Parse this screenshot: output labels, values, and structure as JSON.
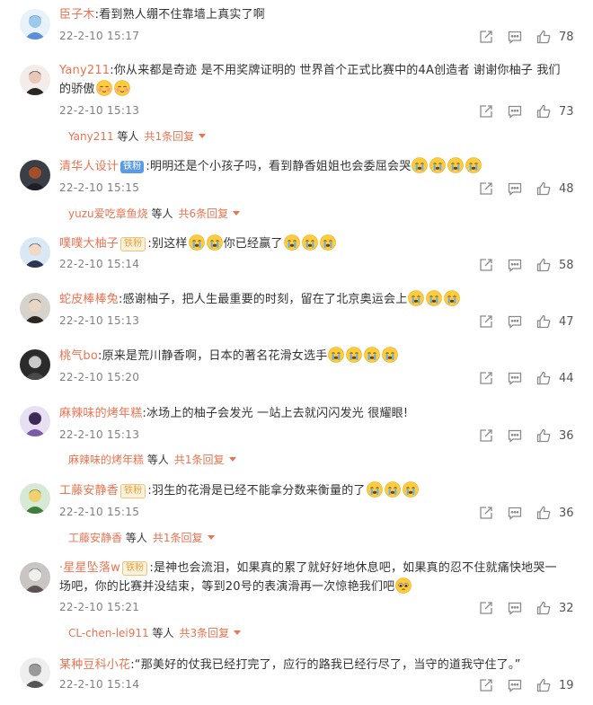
{
  "comments": [
    {
      "user": "臣子木",
      "badge": "",
      "badge_type": "",
      "text": ":看到熟人绷不住靠墙上真实了啊",
      "emojis_after": 0,
      "emoji_kind": "",
      "time": "22-2-10 15:17",
      "likes": "78",
      "reply_user": "",
      "reply_mid": "",
      "reply_more": ""
    },
    {
      "user": "Yany211",
      "badge": "",
      "badge_type": "",
      "text": ":你从来都是奇迹 是不用奖牌证明的 世界首个正式比赛中的4A创造者 谢谢你柚子 我们的骄傲",
      "emojis_after": 2,
      "emoji_kind": "blush",
      "time": "22-2-10 15:13",
      "likes": "73",
      "reply_user": "Yany211",
      "reply_mid": "等人",
      "reply_more": "共1条回复"
    },
    {
      "user": "清华人设计",
      "badge": "铁粉",
      "badge_type": "blue",
      "text": ":明明还是个小孩子吗，看到静香姐姐也会委屈会哭",
      "emojis_after": 4,
      "emoji_kind": "cry",
      "time": "22-2-10 15:15",
      "likes": "48",
      "reply_user": "yuzu爱吃章鱼烧",
      "reply_mid": "等人",
      "reply_more": "共6条回复"
    },
    {
      "user": "噗噗大柚子",
      "badge": "铁粉",
      "badge_type": "gold",
      "text": ":别这样",
      "text2": "你已经赢了",
      "emojis_mid": 2,
      "emojis_after": 3,
      "emoji_kind": "cry",
      "time": "22-2-10 15:14",
      "likes": "58",
      "reply_user": "",
      "reply_mid": "",
      "reply_more": ""
    },
    {
      "user": "蛇皮棒棒兔",
      "badge": "",
      "badge_type": "",
      "text": ":感谢柚子，把人生最重要的时刻，留在了北京奥运会上",
      "emojis_after": 3,
      "emoji_kind": "cry",
      "time": "22-2-10 15:13",
      "likes": "47",
      "reply_user": "",
      "reply_mid": "",
      "reply_more": ""
    },
    {
      "user": "桃气bo",
      "badge": "",
      "badge_type": "",
      "text": ":原来是荒川静香啊，日本的著名花滑女选手",
      "emojis_after": 4,
      "emoji_kind": "cry",
      "time": "22-2-10 15:20",
      "likes": "44",
      "reply_user": "",
      "reply_mid": "",
      "reply_more": ""
    },
    {
      "user": "麻辣味的烤年糕",
      "badge": "",
      "badge_type": "",
      "text": ":冰场上的柚子会发光 一站上去就闪闪发光 很耀眼!",
      "emojis_after": 0,
      "emoji_kind": "",
      "time": "22-2-10 15:13",
      "likes": "36",
      "reply_user": "麻辣味的烤年糕",
      "reply_mid": "等人",
      "reply_more": "共1条回复"
    },
    {
      "user": "工藤安静香",
      "badge": "铁粉",
      "badge_type": "gold",
      "text": ":羽生的花滑是已经不能拿分数来衡量的了",
      "emojis_after": 3,
      "emoji_kind": "cry",
      "time": "22-2-10 15:15",
      "likes": "36",
      "reply_user": "工藤安静香",
      "reply_mid": "等人",
      "reply_more": "共1条回复"
    },
    {
      "user": "·星星坠落w",
      "badge": "铁粉",
      "badge_type": "gold",
      "text": ":是神也会流泪，如果真的累了就好好地休息吧，如果真的忍不住就痛快地哭一场吧，你的比赛并没结束，等到20号的表演滑再一次惊艳我们吧",
      "emojis_after": 1,
      "emoji_kind": "plead",
      "time": "22-2-10 15:21",
      "likes": "32",
      "reply_user": "CL-chen-lei911",
      "reply_mid": "等人",
      "reply_more": "共3条回复"
    },
    {
      "user": "某种豆科小花",
      "badge": "",
      "badge_type": "",
      "text": ":“那美好的仗我已经打完了，应行的路我已经行尽了，当守的道我守住了。”",
      "emojis_after": 0,
      "emoji_kind": "",
      "time": "22-2-10 15:14",
      "likes": "19",
      "reply_user": "",
      "reply_mid": "",
      "reply_more": ""
    }
  ],
  "colors": {
    "username": "#eb7350",
    "text": "#333333",
    "time": "#808080",
    "icon": "#8a8a8a"
  },
  "icons": [
    "share-icon",
    "comment-icon",
    "like-icon",
    "cry-emoji-icon",
    "blush-emoji-icon",
    "plead-emoji-icon",
    "reply-caret-icon"
  ]
}
